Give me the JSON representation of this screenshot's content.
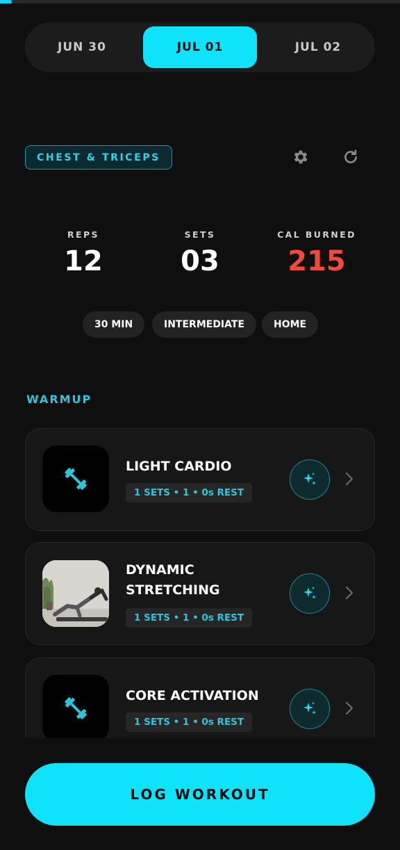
{
  "progress": {
    "fraction": 0.03
  },
  "dates": {
    "tabs": [
      "JUN 30",
      "JUL 01",
      "JUL 02"
    ],
    "active_index": 1
  },
  "workout": {
    "title": "CHEST & TRICEPS"
  },
  "icons": {
    "settings": "gear-icon",
    "refresh": "refresh-icon",
    "dumbbell": "dumbbell-icon",
    "sparkle": "sparkle-icon",
    "chevron": "chevron-right-icon"
  },
  "stats": [
    {
      "label": "REPS",
      "value": "12"
    },
    {
      "label": "SETS",
      "value": "03"
    },
    {
      "label": "CAL BURNED",
      "value": "215"
    }
  ],
  "tags": [
    "30 MIN",
    "INTERMEDIATE",
    "HOME"
  ],
  "section": {
    "title": "WARMUP"
  },
  "exercises": [
    {
      "name": "LIGHT CARDIO",
      "meta": "1 SETS • 1 • 0s REST",
      "thumb": "dumbbell-icon"
    },
    {
      "name": "DYNAMIC STRETCHING",
      "meta": "1 SETS • 1 • 0s REST",
      "thumb": "yoga-photo"
    },
    {
      "name": "CORE ACTIVATION",
      "meta": "1 SETS • 1 • 0s REST",
      "thumb": "dumbbell-icon"
    }
  ],
  "cta": {
    "label": "LOG WORKOUT"
  },
  "colors": {
    "accent": "#0fe3fb",
    "teal_text": "#2cc6dd",
    "calories": "#ef4a3a",
    "background": "#0f0f0f"
  }
}
